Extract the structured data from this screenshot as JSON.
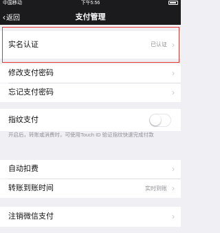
{
  "status_bar": {
    "carrier": "中国移动",
    "time": "下午5:56",
    "battery": ""
  },
  "nav": {
    "back_label": "返回",
    "title": "支付管理"
  },
  "sections": {
    "realname": {
      "label": "实名认证",
      "value": "已认证"
    },
    "change_pwd": {
      "label": "修改支付密码"
    },
    "forgot_pwd": {
      "label": "忘记支付密码"
    },
    "fingerprint": {
      "label": "指纹支付",
      "enabled": false,
      "description": "开启后，转账或消费时，可使用Touch ID 验证指纹快速完成付款"
    },
    "auto_debit": {
      "label": "自动扣费"
    },
    "transfer_time": {
      "label": "转账到账时间",
      "value": "实时到账"
    },
    "cancel": {
      "label": "注销微信支付"
    }
  },
  "colors": {
    "nav_bg": "#1b1b1d",
    "highlight": "#e8342c",
    "background": "#efeff4"
  }
}
